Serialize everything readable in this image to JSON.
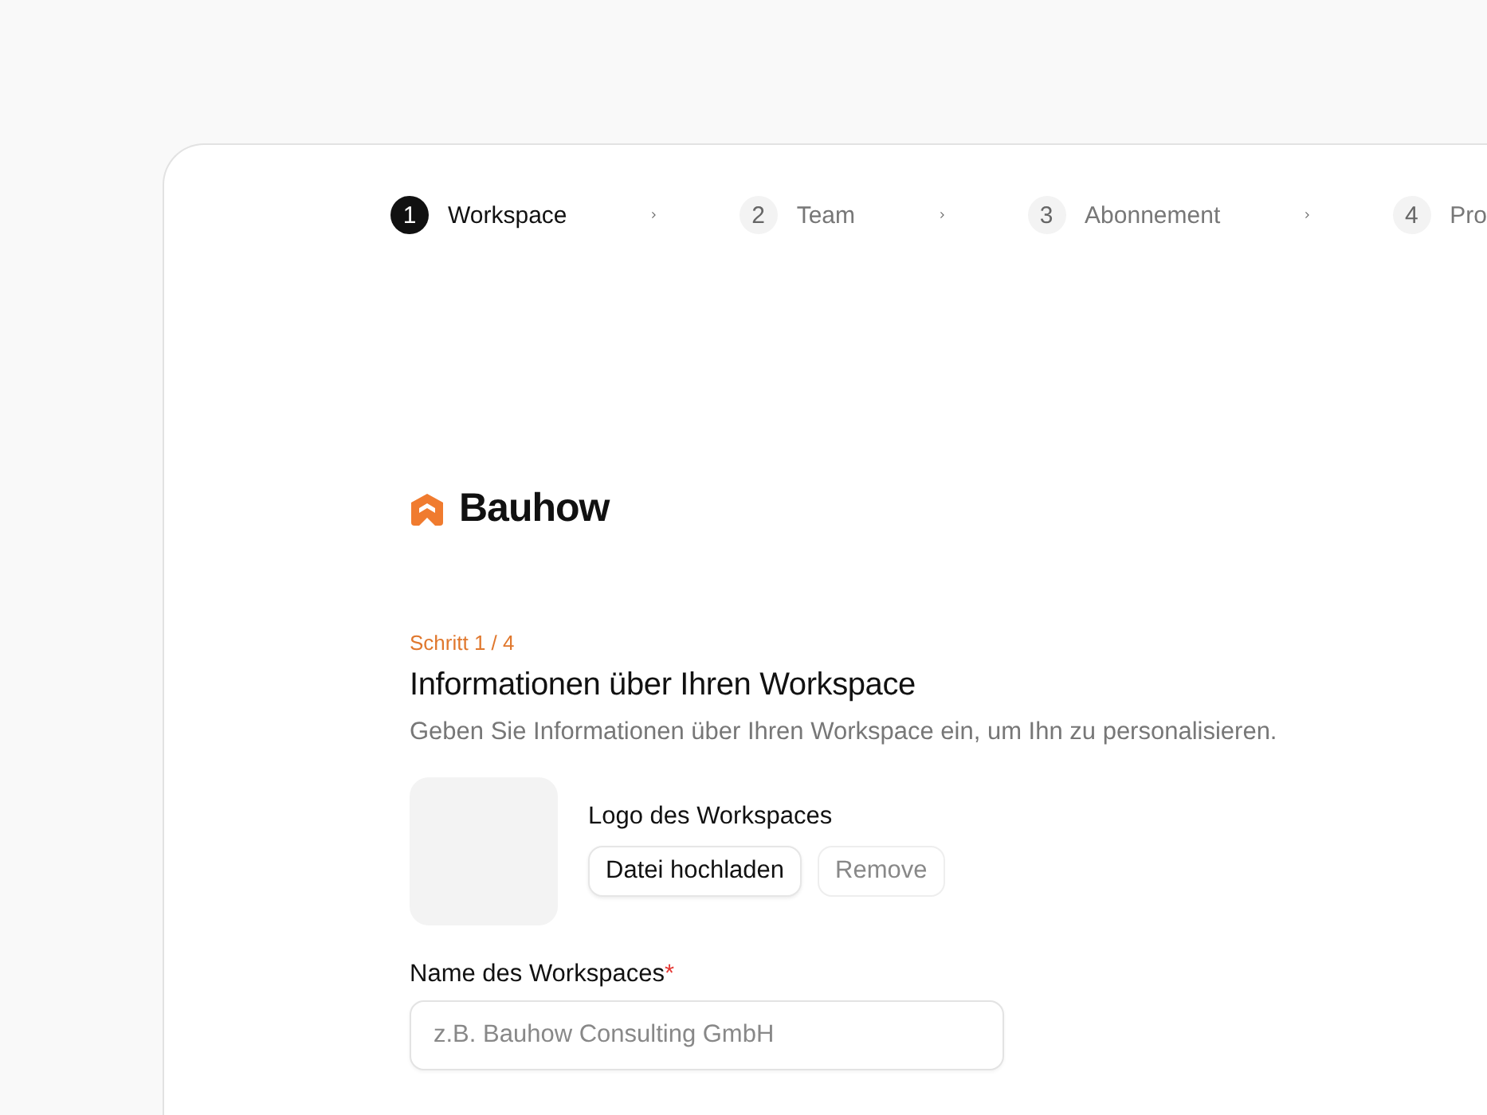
{
  "steps": [
    {
      "number": "1",
      "label": "Workspace",
      "selected": true
    },
    {
      "number": "2",
      "label": "Team",
      "selected": false
    },
    {
      "number": "3",
      "label": "Abonnement",
      "selected": false
    },
    {
      "number": "4",
      "label": "Pro",
      "selected": false
    }
  ],
  "brand": {
    "name": "Bauhow"
  },
  "form": {
    "step_label": "Schritt 1 / 4",
    "title": "Informationen über Ihren Workspace",
    "description": "Geben Sie Informationen über Ihren Workspace ein, um Ihn zu personalisieren.",
    "logo": {
      "label": "Logo des Workspaces",
      "upload_button": "Datei hochladen",
      "remove_button": "Remove"
    },
    "name_field": {
      "label": "Name des Workspaces",
      "required_mark": "*",
      "placeholder": "z.B. Bauhow Consulting GmbH"
    }
  }
}
